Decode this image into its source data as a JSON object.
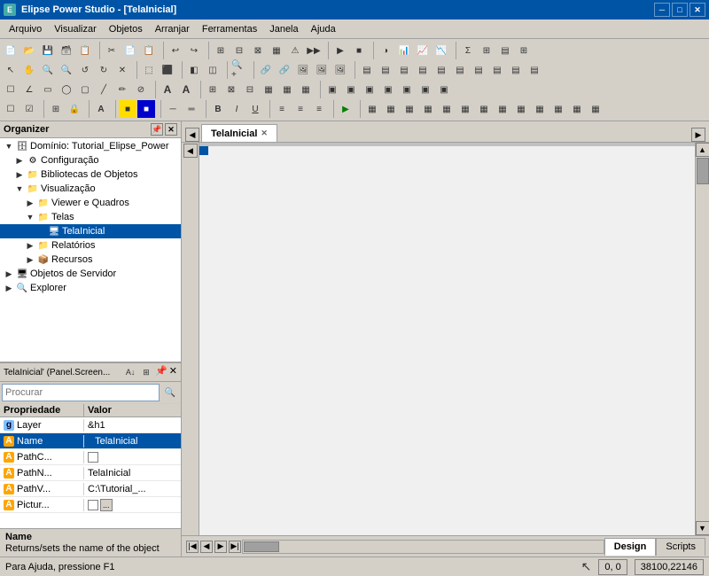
{
  "titleBar": {
    "title": "Elipse Power Studio - [TelaInicial]",
    "icon": "E",
    "minBtn": "─",
    "maxBtn": "□",
    "closeBtn": "✕"
  },
  "menuBar": {
    "items": [
      "Arquivo",
      "Visualizar",
      "Objetos",
      "Arranjar",
      "Ferramentas",
      "Janela",
      "Ajuda"
    ]
  },
  "organizer": {
    "title": "Organizer",
    "searchPlaceholder": "Procurar",
    "tree": [
      {
        "level": 0,
        "toggle": "▼",
        "icon": "🗄",
        "label": "Domínio: Tutorial_Elipse_Power",
        "expanded": true
      },
      {
        "level": 1,
        "toggle": "▶",
        "icon": "⚙",
        "label": "Configuração",
        "expanded": false
      },
      {
        "level": 1,
        "toggle": "▶",
        "icon": "📁",
        "label": "Bibliotecas de Objetos",
        "expanded": false
      },
      {
        "level": 1,
        "toggle": "▼",
        "icon": "📁",
        "label": "Visualização",
        "expanded": true
      },
      {
        "level": 2,
        "toggle": "▶",
        "icon": "📁",
        "label": "Viewer e Quadros",
        "expanded": false
      },
      {
        "level": 2,
        "toggle": "▼",
        "icon": "📁",
        "label": "Telas",
        "expanded": true
      },
      {
        "level": 3,
        "toggle": "",
        "icon": "🖥",
        "label": "TelaInicial",
        "selected": true
      },
      {
        "level": 2,
        "toggle": "▶",
        "icon": "📁",
        "label": "Relatórios",
        "expanded": false
      },
      {
        "level": 2,
        "toggle": "▶",
        "icon": "📦",
        "label": "Recursos",
        "expanded": false
      },
      {
        "level": 0,
        "toggle": "▶",
        "icon": "🖥",
        "label": "Objetos de Servidor",
        "expanded": false
      },
      {
        "level": 0,
        "toggle": "▶",
        "icon": "🔍",
        "label": "Explorer",
        "expanded": false
      }
    ]
  },
  "propsPanel": {
    "title": "TelaInicial' (Panel.Screen...",
    "searchPlaceholder": "Procurar",
    "columns": {
      "prop": "Propriedade",
      "val": "Valor"
    },
    "rows": [
      {
        "type": "g",
        "name": "Layer",
        "value": "&h1",
        "checkbox": false,
        "selected": false
      },
      {
        "type": "a",
        "name": "Name",
        "value": "TelaInicial",
        "diamond": true,
        "selected": true
      },
      {
        "type": "a",
        "name": "PathC...",
        "value": "",
        "checkbox": true,
        "selected": false
      },
      {
        "type": "a",
        "name": "PathN...",
        "value": "TelaInicial",
        "selected": false
      },
      {
        "type": "a",
        "name": "PathV...",
        "value": "C:\\Tutorial_...",
        "selected": false
      },
      {
        "type": "a",
        "name": "Pictur...",
        "value": "",
        "checkbox": true,
        "hasBtn": true,
        "selected": false
      }
    ],
    "infoName": "Name",
    "infoDesc": "Returns/sets the name of the object"
  },
  "tabs": {
    "active": "TelaInicial",
    "items": [
      {
        "label": "TelaInicial",
        "closeable": true
      }
    ]
  },
  "bottomTabs": {
    "items": [
      {
        "label": "Design",
        "active": true
      },
      {
        "label": "Scripts",
        "active": false
      }
    ]
  },
  "statusBar": {
    "helpText": "Para Ajuda, pressione F1",
    "coords": "0, 0",
    "size": "38100,22146"
  },
  "canvas": {
    "background": "#f0f0f0"
  }
}
